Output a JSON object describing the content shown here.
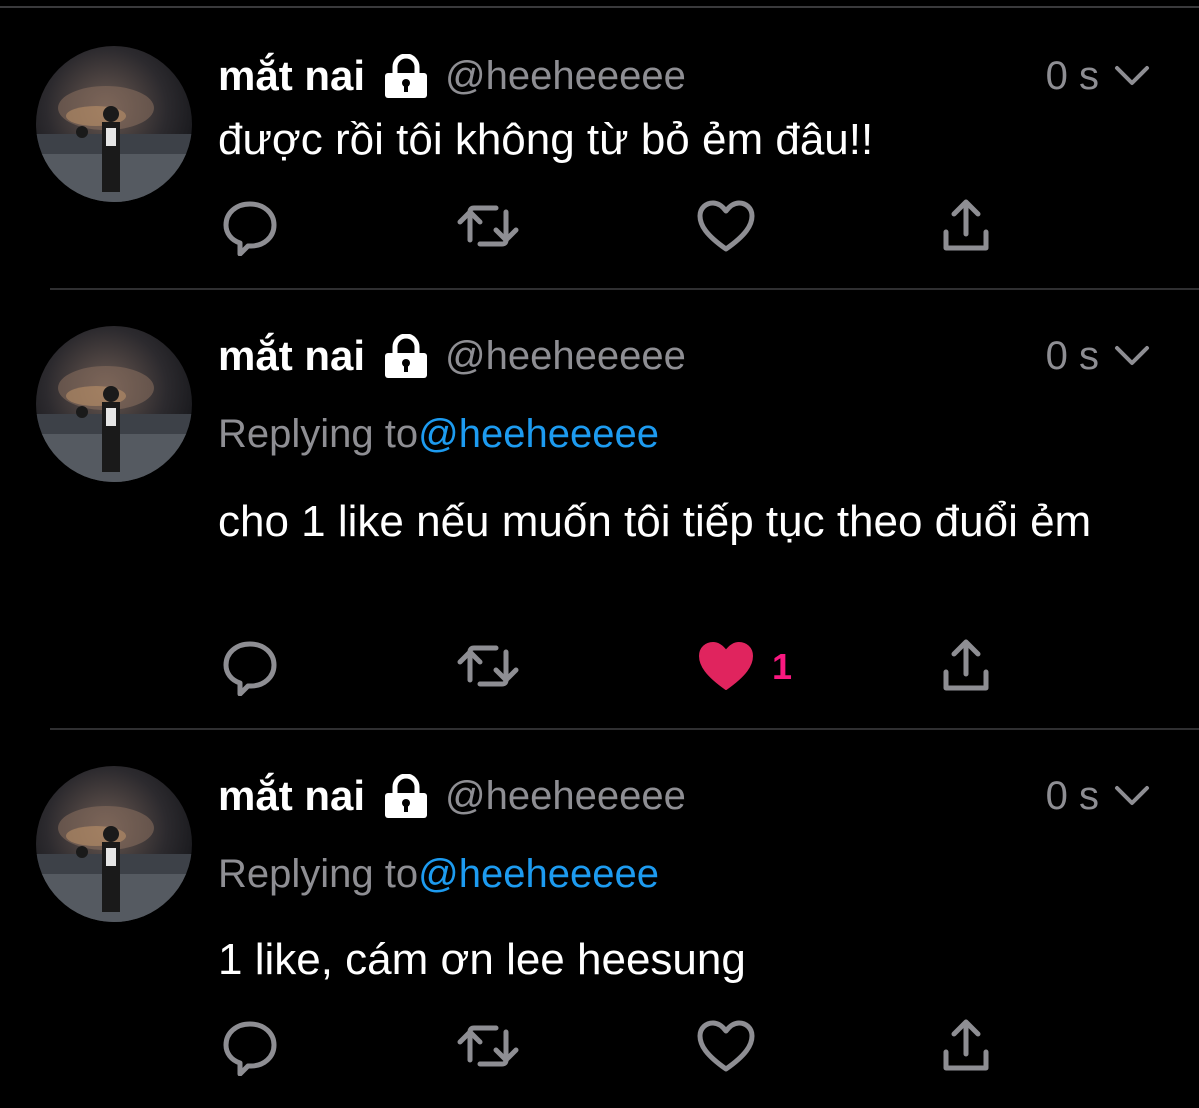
{
  "tweets": [
    {
      "name": "mắt nai",
      "handle": "@heeheeeee",
      "time": "0 s",
      "replying_label": "",
      "replying_handle": "",
      "text": "được rồi tôi không từ bỏ ẻm đâu!!",
      "likes": "",
      "liked": false
    },
    {
      "name": "mắt nai",
      "handle": "@heeheeeee",
      "time": "0 s",
      "replying_label": "Replying to",
      "replying_handle": "@heeheeeee",
      "text": "cho 1 like nếu muốn tôi tiếp tục theo đuổi ẻm",
      "likes": "1",
      "liked": true
    },
    {
      "name": "mắt nai",
      "handle": "@heeheeeee",
      "time": "0 s",
      "replying_label": "Replying to",
      "replying_handle": "@heeheeeee",
      "text": "1 like, cám ơn lee heesung",
      "likes": "",
      "liked": false
    }
  ],
  "icons": {
    "reply": "reply-icon",
    "retweet": "retweet-icon",
    "like": "heart-icon",
    "share": "share-icon",
    "lock": "lock-icon",
    "menu": "chevron-down-icon"
  },
  "colors": {
    "background": "#000000",
    "text": "#ffffff",
    "secondary": "#8e8e93",
    "mention": "#1d9bf0",
    "liked": "#f91880",
    "divider": "#2f2f31"
  }
}
